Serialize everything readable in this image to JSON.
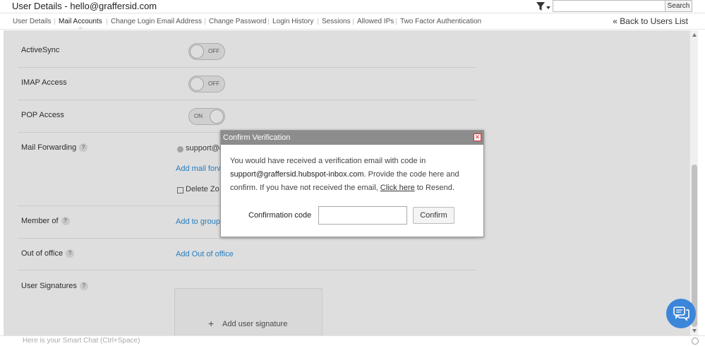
{
  "header": {
    "title": "User Details - hello@graffersid.com",
    "search_placeholder": "",
    "search_button": "Search"
  },
  "tabs": [
    {
      "label": "User Details"
    },
    {
      "label": "Mail Accounts"
    },
    {
      "label": "Change Login Email Address"
    },
    {
      "label": "Change Password"
    },
    {
      "label": "Login History"
    },
    {
      "label": "Sessions"
    },
    {
      "label": "Allowed IPs"
    },
    {
      "label": "Two Factor Authentication"
    }
  ],
  "back_link": "« Back to Users List",
  "settings": {
    "activesync": {
      "label": "ActiveSync",
      "state": "OFF"
    },
    "imap": {
      "label": "IMAP Access",
      "state": "OFF"
    },
    "pop": {
      "label": "POP Access",
      "state": "ON"
    },
    "forwarding": {
      "label": "Mail Forwarding",
      "help": "?",
      "address": "support@g",
      "add_link": "Add mail forw",
      "delete_label": "Delete Zo"
    },
    "member_of": {
      "label": "Member of",
      "help": "?",
      "link": "Add to group"
    },
    "out_of_office": {
      "label": "Out of office",
      "help": "?",
      "link": "Add Out of office"
    },
    "signatures": {
      "label": "User Signatures",
      "help": "?",
      "add_label": "Add user signature"
    }
  },
  "dialog": {
    "title": "Confirm Verification",
    "message_before": "You would have received a verification email with code in ",
    "email": "support@graffersid.hubspot-inbox.com",
    "message_middle": ". Provide the code here and confirm. If you have not received the email, ",
    "click_here": "Click here",
    "message_after": " to Resend.",
    "code_label": "Confirmation code",
    "code_value": "",
    "confirm_button": "Confirm"
  },
  "smart_chat": {
    "placeholder": "Here is your Smart Chat (Ctrl+Space)"
  },
  "colors": {
    "link": "#2f8fd8",
    "dialog_header": "#8c8c8c",
    "chat_bubble": "#3b86d9"
  }
}
